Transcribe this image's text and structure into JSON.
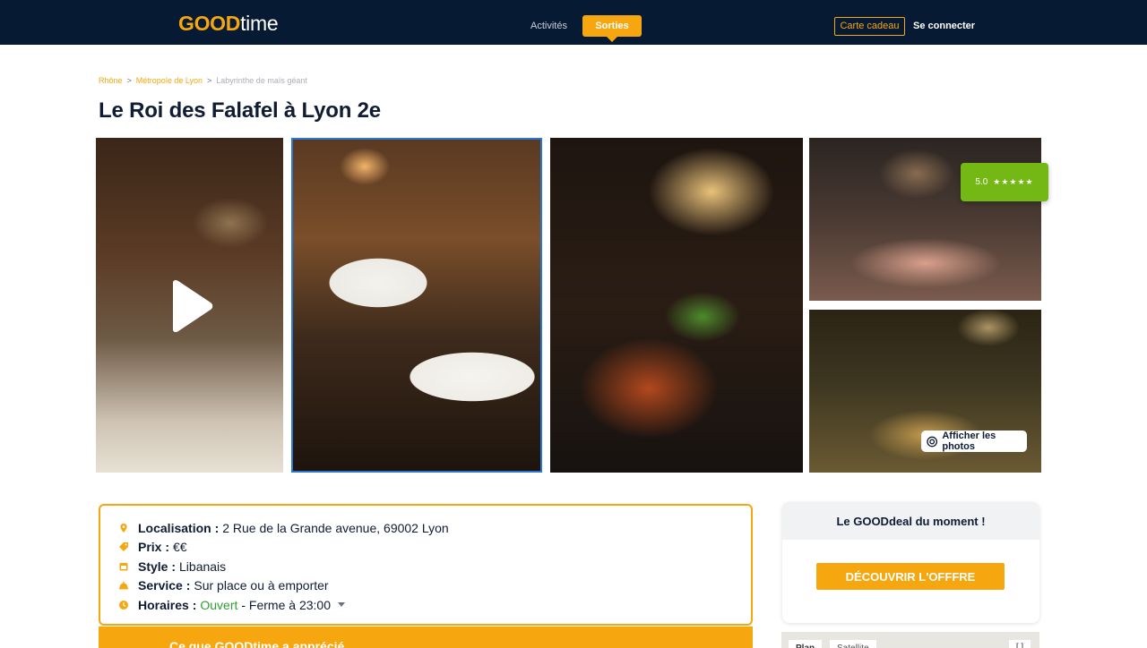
{
  "header": {
    "logo_good": "GOOD",
    "logo_time": "time",
    "nav": {
      "activites": "Activités",
      "sorties": "Sorties"
    },
    "gift_card": "Carte cadeau",
    "login": "Se connecter"
  },
  "breadcrumb": {
    "items": [
      "Rhône",
      "Métropole de Lyon",
      "Labyrinthe de maïs géant"
    ],
    "separator": ">"
  },
  "title": "Le Roi des Falafel à Lyon 2e",
  "gallery": {
    "rating": "5.0",
    "stars": "★★★★★",
    "show_photos": "Afficher les photos"
  },
  "info": {
    "location": {
      "label": "Localisation :",
      "value": "2 Rue de la Grande avenue, 69002 Lyon"
    },
    "price": {
      "label": "Prix :",
      "value": "€€"
    },
    "style": {
      "label": "Style :",
      "value": "Libanais"
    },
    "service": {
      "label": "Service :",
      "value": "Sur place ou à emporter"
    },
    "hours": {
      "label": "Horaires :",
      "status": "Ouvert",
      "rest": "- Ferme à 23:00"
    }
  },
  "appreciated": "Ce que GOODtime a apprécié",
  "deal": {
    "title": "Le GOODdeal du moment !",
    "button": "DÉCOUVRIR L'OFFFRE"
  },
  "map": {
    "tab_plan": "Plan",
    "tab_satellite": "Satellite",
    "zoom_control": "[ ]"
  },
  "colors": {
    "brand_orange": "#f6a70f",
    "header_navy": "#071a33",
    "rating_green": "#73b814",
    "open_green": "#2f9e2f",
    "selected_blue": "#2a78d4"
  }
}
